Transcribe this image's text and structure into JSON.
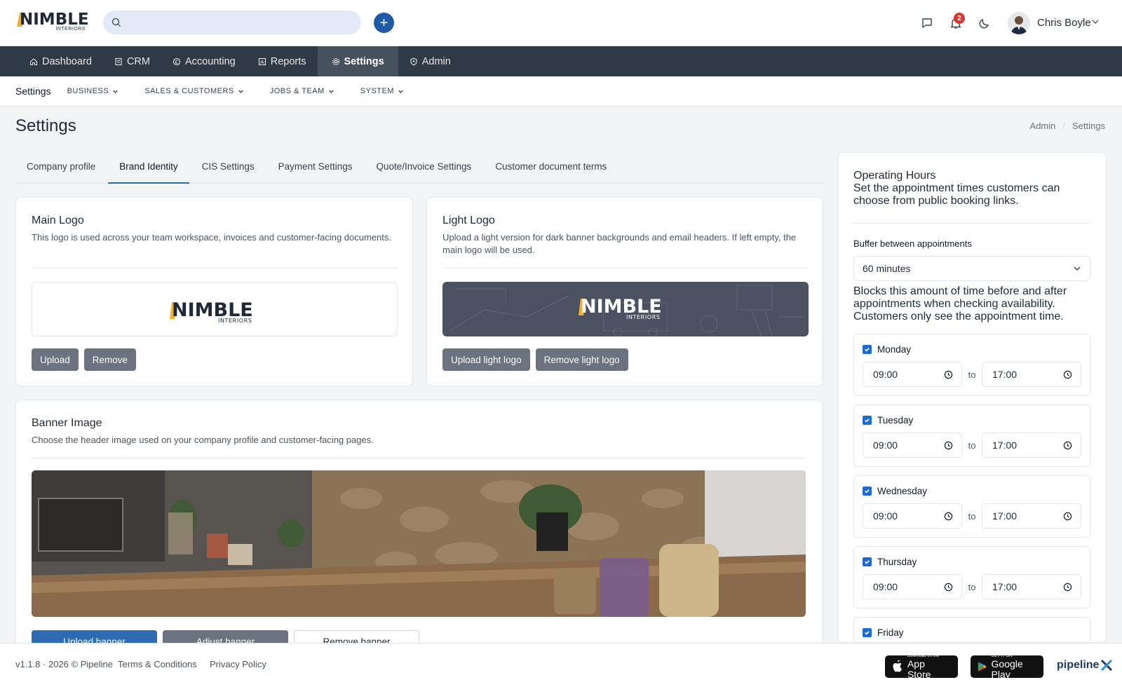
{
  "brand": {
    "logo_word": "NIMBLE",
    "logo_sub": "INTERIORS"
  },
  "search": {
    "placeholder": "",
    "value": ""
  },
  "header": {
    "notifications_count": "2",
    "user_name": "Chris Boyle"
  },
  "nav": {
    "items": [
      {
        "label": "Dashboard",
        "icon": "home-icon"
      },
      {
        "label": "CRM",
        "icon": "document-icon"
      },
      {
        "label": "Accounting",
        "icon": "coin-icon"
      },
      {
        "label": "Reports",
        "icon": "chart-icon"
      },
      {
        "label": "Settings",
        "icon": "gear-icon"
      },
      {
        "label": "Admin",
        "icon": "shield-icon"
      }
    ],
    "active": "Settings"
  },
  "subnav": {
    "title": "Settings",
    "items": [
      "BUSINESS",
      "SALES & CUSTOMERS",
      "JOBS & TEAM",
      "SYSTEM"
    ]
  },
  "page": {
    "title": "Settings",
    "breadcrumb": [
      "Admin",
      "Settings"
    ]
  },
  "tabs": {
    "items": [
      "Company profile",
      "Brand Identity",
      "CIS Settings",
      "Payment Settings",
      "Quote/Invoice Settings",
      "Customer document terms"
    ],
    "active": "Brand Identity"
  },
  "main_logo": {
    "title": "Main Logo",
    "description": "This logo is used across your team workspace, invoices and customer-facing documents.",
    "upload_label": "Upload",
    "remove_label": "Remove"
  },
  "light_logo": {
    "title": "Light Logo",
    "description": "Upload a light version for dark banner backgrounds and email headers. If left empty, the main logo will be used.",
    "upload_label": "Upload light logo",
    "remove_label": "Remove light logo"
  },
  "banner": {
    "title": "Banner Image",
    "description": "Choose the header image used on your company profile and customer-facing pages.",
    "upload_label": "Upload banner",
    "adjust_label": "Adjust banner",
    "remove_label": "Remove banner"
  },
  "operating_hours": {
    "title": "Operating Hours",
    "description": "Set the appointment times customers can choose from public booking links.",
    "buffer_label": "Buffer between appointments",
    "buffer_value": "60 minutes",
    "buffer_help": "Blocks this amount of time before and after appointments when checking availability. Customers only see the appointment time.",
    "to_label": "to",
    "days": [
      {
        "name": "Monday",
        "checked": true,
        "start": "09:00",
        "end": "17:00"
      },
      {
        "name": "Tuesday",
        "checked": true,
        "start": "09:00",
        "end": "17:00"
      },
      {
        "name": "Wednesday",
        "checked": true,
        "start": "09:00",
        "end": "17:00"
      },
      {
        "name": "Thursday",
        "checked": true,
        "start": "09:00",
        "end": "17:00"
      },
      {
        "name": "Friday",
        "checked": true,
        "start": "",
        "end": ""
      }
    ]
  },
  "footer": {
    "version": "v1.1.8 · 2026 © Pipeline",
    "terms": "Terms & Conditions",
    "privacy": "Privacy Policy",
    "app_store_small": "Download on the",
    "app_store_big": "App Store",
    "google_small": "GET IT ON",
    "google_big": "Google Play",
    "pipeline_logo": "pipeline"
  },
  "colors": {
    "nav_bg": "#2f3a47",
    "accent": "#1f5aa6",
    "badge": "#d93636",
    "button_gray": "#6b7280",
    "checkbox": "#1f6ad0"
  }
}
